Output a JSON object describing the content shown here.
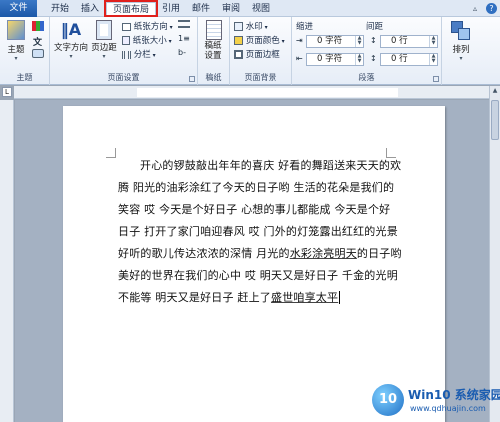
{
  "tabs": {
    "file": "文件",
    "home": "开始",
    "insert": "插入",
    "page_layout": "页面布局",
    "references": "引用",
    "mailings": "邮件",
    "review": "审阅",
    "view": "视图"
  },
  "ribbon": {
    "theme_group": {
      "label": "主题",
      "theme_button": "主题"
    },
    "page_setup": {
      "label": "页面设置",
      "text_direction": "文字方向",
      "margins": "页边距",
      "orientation": "纸张方向",
      "size": "纸张大小",
      "columns": "分栏"
    },
    "manuscript": {
      "label": "稿纸",
      "button": "稿纸设置"
    },
    "page_background": {
      "label": "页面背景",
      "watermark": "水印",
      "page_color": "页面颜色",
      "page_borders": "页面边框"
    },
    "paragraph": {
      "label": "段落",
      "indent_title": "缩进",
      "spacing_title": "间距",
      "indent_left": "0 字符",
      "indent_right": "0 字符",
      "spacing_before": "0 行",
      "spacing_after": "0 行"
    },
    "arrange": {
      "button": "排列"
    }
  },
  "document": {
    "lines": [
      "开心的锣鼓敲出年年的喜庆  好看的舞蹈送来天天的欢",
      "腾  阳光的油彩涂红了今天的日子哟  生活的花朵是我们的",
      "笑容  哎  今天是个好日子  心想的事儿都能成  今天是个好",
      "日子  打开了家门咱迎春风  哎  门外的灯笼露出红红的光景",
      "好听的歌儿传达浓浓的深情  月光的",
      "美好的世界在我们的心中  哎  明天又是好日子  千金的光明",
      "不能等  明天又是好日子  赶上了"
    ],
    "line5_underlined": "水彩涂亮明天",
    "line5_tail": "的日子哟",
    "line7_underlined": "盛世咱享太平"
  },
  "watermark": {
    "brand": "Win10 系统家园",
    "url": "www.qdhuajin.com"
  }
}
